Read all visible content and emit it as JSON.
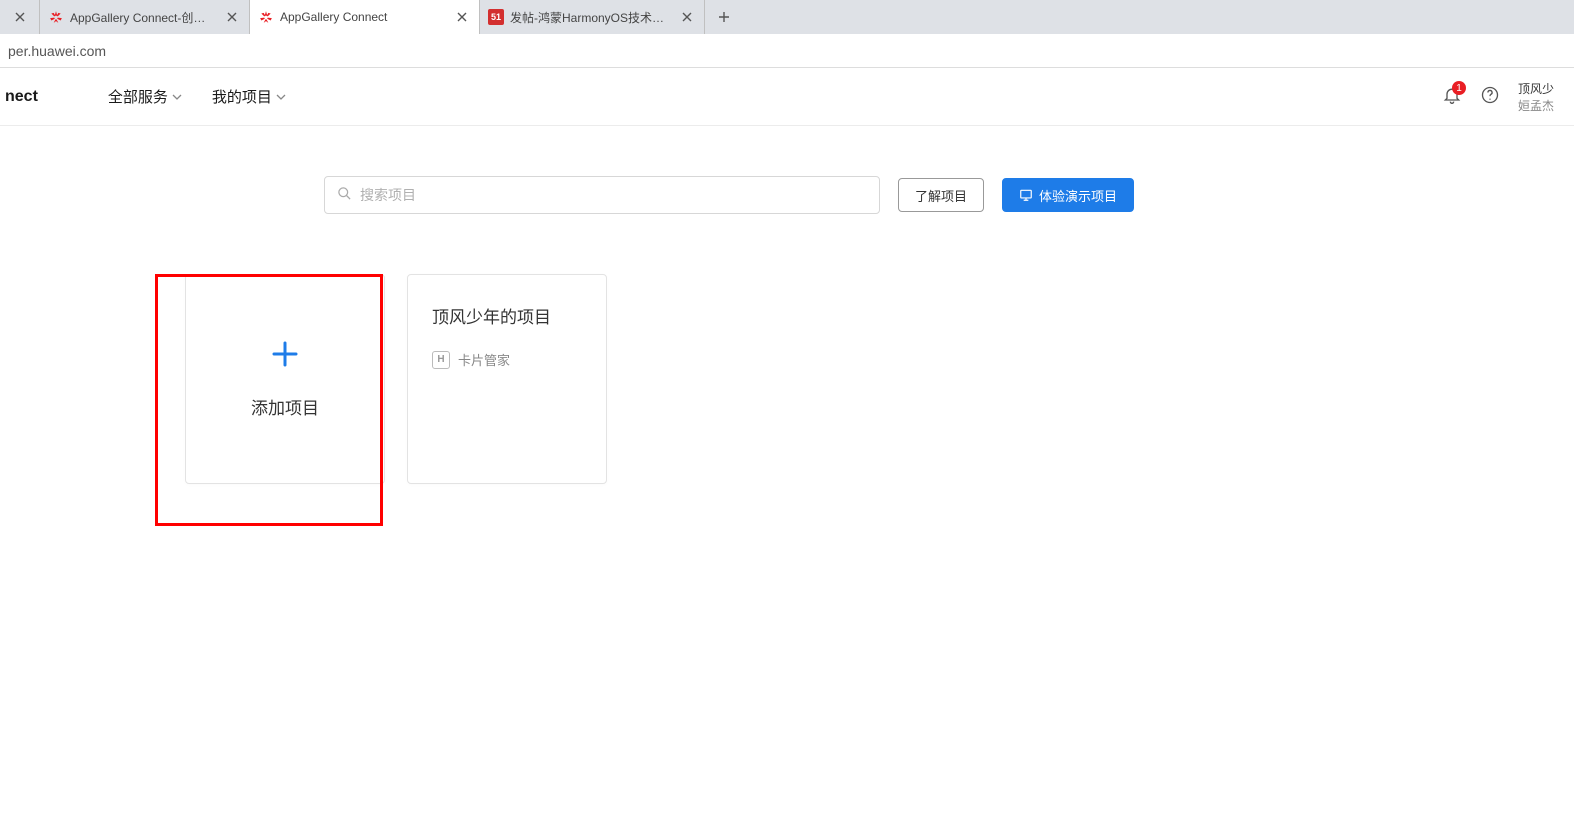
{
  "browser": {
    "tabs": [
      {
        "title": "",
        "favicon": "none"
      },
      {
        "title": "AppGallery Connect-创建您的A",
        "favicon": "huawei"
      },
      {
        "title": "AppGallery Connect",
        "favicon": "huawei",
        "active": true
      },
      {
        "title": "发帖-鸿蒙HarmonyOS技术社区",
        "favicon": "51"
      }
    ],
    "url": "per.huawei.com"
  },
  "topnav": {
    "logo_text": "nect",
    "items": [
      {
        "label": "全部服务"
      },
      {
        "label": "我的项目"
      }
    ],
    "notification_count": "1",
    "user_line1": "顶风少",
    "user_line2": "姮孟杰"
  },
  "toolbar": {
    "search_placeholder": "搜索项目",
    "learn_label": "了解项目",
    "demo_label": "体验演示项目"
  },
  "cards": {
    "add_label": "添加项目",
    "projects": [
      {
        "name": "顶风少年的项目",
        "app": "卡片管家",
        "app_badge": "H"
      }
    ]
  }
}
